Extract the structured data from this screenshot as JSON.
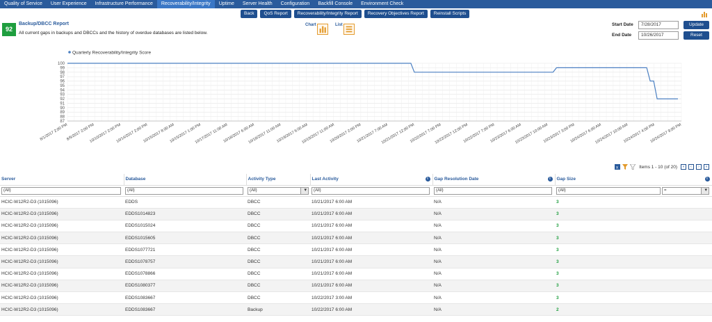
{
  "nav": {
    "tabs": [
      {
        "label": "Quality of Service"
      },
      {
        "label": "User Experience"
      },
      {
        "label": "Infrastructure Performance"
      },
      {
        "label": "Recoverability/Integrity"
      },
      {
        "label": "Uptime"
      },
      {
        "label": "Server Health"
      },
      {
        "label": "Configuration"
      },
      {
        "label": "Backfill Console"
      },
      {
        "label": "Environment Check"
      }
    ],
    "active_index": 3,
    "accent": "#2a5b9c",
    "icon": "bar-chart-icon"
  },
  "toolbar": {
    "back": "Back",
    "qos": "QoS Report",
    "recov": "Recoverability/Integrity Report",
    "recobj": "Recovery Objectives Report",
    "reinstall": "Reinstall Scripts"
  },
  "report": {
    "score": "92",
    "title": "Backup/DBCC Report",
    "description": "All current gaps in backups and DBCCs and the history of overdue databases are listed below.",
    "chart_view": "Chart",
    "list_view": "List"
  },
  "dates": {
    "start_label": "Start Date",
    "start_value": "7/28/2017",
    "end_label": "End Date",
    "end_value": "10/26/2017",
    "update": "Update",
    "reset": "Reset"
  },
  "chart_data": {
    "type": "line",
    "series": [
      {
        "name": "Quarterly Recoverability/Integrity Score",
        "values": [
          100,
          100,
          100,
          100,
          100,
          100,
          100,
          100,
          100,
          100,
          100,
          100,
          100,
          100,
          100,
          100,
          100,
          100,
          100,
          100,
          100,
          100,
          100,
          100,
          100,
          100,
          100,
          100,
          100,
          100,
          100,
          100,
          100,
          100,
          100,
          100,
          100,
          100,
          100,
          100,
          100,
          100,
          100,
          100,
          100,
          100,
          100,
          100,
          100,
          100,
          100,
          100,
          100,
          100,
          100,
          100,
          100,
          100,
          100,
          100,
          100,
          100,
          100,
          100,
          100,
          100,
          100,
          100,
          100,
          100,
          100,
          100,
          100,
          100,
          100,
          100,
          100,
          100,
          100,
          100,
          100,
          100,
          100,
          100,
          100,
          100,
          100,
          100,
          100,
          100,
          100,
          100,
          100,
          100,
          100,
          100,
          100,
          100,
          100,
          100,
          98,
          98,
          98,
          98,
          98,
          98,
          98,
          98,
          98,
          98,
          98,
          98,
          98,
          98,
          98,
          98,
          98,
          98,
          98,
          98,
          98,
          98,
          98,
          98,
          98,
          98,
          98,
          98,
          98,
          98,
          98,
          98,
          98,
          98,
          98,
          98,
          98,
          98,
          98,
          98,
          98,
          99,
          99,
          99,
          99,
          99,
          99,
          99,
          99,
          99,
          99,
          99,
          99,
          99,
          99,
          99,
          99,
          99,
          99,
          99,
          99,
          99,
          99,
          99,
          99,
          99,
          99,
          99,
          96,
          96,
          92,
          92,
          92,
          92,
          92,
          92,
          92
        ]
      }
    ],
    "x_tick_labels": [
      "8/1/2017 2:00 PM",
      "8/5/2017 2:00 PM",
      "10/10/2017 2:00 PM",
      "10/14/2017 2:00 PM",
      "10/15/2017 8:00 AM",
      "10/15/2017 1:00 PM",
      "10/17/2017 11:00 AM",
      "10/18/2017 6:00 AM",
      "10/18/2017 11:00 AM",
      "10/19/2017 6:00 AM",
      "10/19/2017 11:00 AM",
      "10/20/2017 2:00 PM",
      "10/21/2017 7:00 AM",
      "10/21/2017 12:00 PM",
      "10/22/2017 7:00 PM",
      "10/22/2017 12:00 PM",
      "10/22/2017 7:00 PM",
      "10/23/2017 6:00 AM",
      "10/23/2017 10:00 AM",
      "10/23/2017 3:00 PM",
      "10/24/2017 6:00 AM",
      "10/24/2017 10:00 AM",
      "10/24/2017 4:00 PM",
      "10/24/2017 9:00 PM"
    ],
    "ylim": [
      87,
      100
    ],
    "y_ticks": [
      100,
      99,
      98,
      97,
      96,
      95,
      94,
      93,
      92,
      91,
      90,
      89,
      88,
      87
    ],
    "grid": true,
    "legend": "top-left",
    "color": "#4a7fc1"
  },
  "grid": {
    "pager": "Items 1 - 10 (of 20)",
    "pager_buttons": [
      "«",
      "‹",
      "›",
      "»"
    ],
    "columns": [
      "Server",
      "Database",
      "Activity Type",
      "Last Activity",
      "Gap Resolution Date",
      "Gap Size"
    ],
    "filters": {
      "server": "(All)",
      "database": "(All)",
      "activity": "(All)",
      "last": "(All)",
      "gapres": "(All)",
      "gapsize": "(All)",
      "op": "="
    },
    "rows": [
      {
        "server": "HCIC-W12R2-D3 (1015096)",
        "database": "EDDS",
        "activity": "DBCC",
        "last": "10/21/2017 6:00 AM",
        "gapres": "N/A",
        "gap": "3"
      },
      {
        "server": "HCIC-W12R2-D3 (1015096)",
        "database": "EDDS1014823",
        "activity": "DBCC",
        "last": "10/21/2017 6:00 AM",
        "gapres": "N/A",
        "gap": "3"
      },
      {
        "server": "HCIC-W12R2-D3 (1015096)",
        "database": "EDDS1015024",
        "activity": "DBCC",
        "last": "10/21/2017 6:00 AM",
        "gapres": "N/A",
        "gap": "3"
      },
      {
        "server": "HCIC-W12R2-D3 (1015096)",
        "database": "EDDS1015605",
        "activity": "DBCC",
        "last": "10/21/2017 6:00 AM",
        "gapres": "N/A",
        "gap": "3"
      },
      {
        "server": "HCIC-W12R2-D3 (1015096)",
        "database": "EDDS1077721",
        "activity": "DBCC",
        "last": "10/21/2017 6:00 AM",
        "gapres": "N/A",
        "gap": "3"
      },
      {
        "server": "HCIC-W12R2-D3 (1015096)",
        "database": "EDDS1078757",
        "activity": "DBCC",
        "last": "10/21/2017 6:00 AM",
        "gapres": "N/A",
        "gap": "3"
      },
      {
        "server": "HCIC-W12R2-D3 (1015096)",
        "database": "EDDS1078866",
        "activity": "DBCC",
        "last": "10/21/2017 6:00 AM",
        "gapres": "N/A",
        "gap": "3"
      },
      {
        "server": "HCIC-W12R2-D3 (1015096)",
        "database": "EDDS1080377",
        "activity": "DBCC",
        "last": "10/21/2017 6:00 AM",
        "gapres": "N/A",
        "gap": "3"
      },
      {
        "server": "HCIC-W12R2-D3 (1015096)",
        "database": "EDDS1083667",
        "activity": "DBCC",
        "last": "10/22/2017 3:00 AM",
        "gapres": "N/A",
        "gap": "3"
      },
      {
        "server": "HCIC-W12R2-D3 (1015096)",
        "database": "EDDS1083667",
        "activity": "Backup",
        "last": "10/22/2017 6:00 AM",
        "gapres": "N/A",
        "gap": "2"
      }
    ]
  }
}
